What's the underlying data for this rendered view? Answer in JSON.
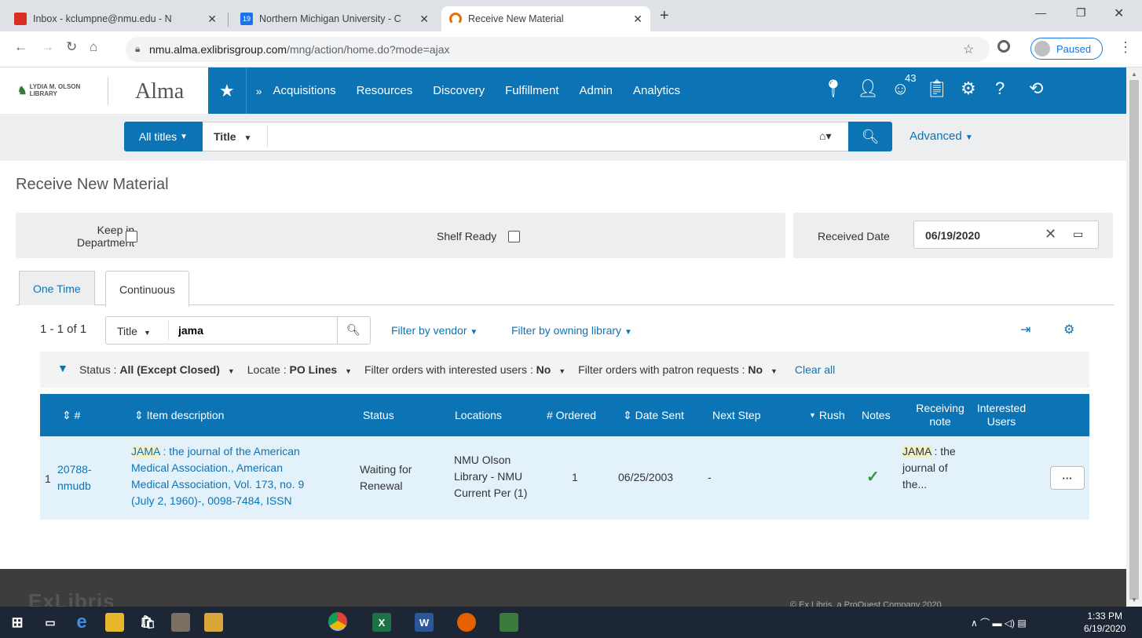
{
  "browser": {
    "tabs": [
      {
        "title": "Inbox - kclumpne@nmu.edu - N",
        "icon": "gmail-icon"
      },
      {
        "title": "Northern Michigan University - C",
        "icon": "calendar-icon",
        "badge": "19"
      },
      {
        "title": "Receive New Material",
        "icon": "exlibris-icon"
      }
    ],
    "url_host": "nmu.alma.exlibrisgroup.com",
    "url_path": "/mng/action/home.do?mode=ajax",
    "profile_label": "Paused"
  },
  "alma": {
    "library_logo_text": "LYDIA M. OLSON LIBRARY",
    "app_name": "Alma",
    "nav_items": [
      "Acquisitions",
      "Resources",
      "Discovery",
      "Fulfillment",
      "Admin",
      "Analytics"
    ],
    "task_badge": "43"
  },
  "search": {
    "scope": "All titles",
    "field": "Title",
    "value": "",
    "advanced": "Advanced"
  },
  "page": {
    "title": "Receive New Material",
    "keep_in_department_line1": "Keep in",
    "keep_in_department_line2": "Department",
    "shelf_ready": "Shelf Ready",
    "received_date_label": "Received Date",
    "received_date_value": "06/19/2020",
    "tabs": [
      "One Time",
      "Continuous"
    ],
    "active_tab": "Continuous"
  },
  "list": {
    "count": "1 - 1 of 1",
    "search_field": "Title",
    "search_value": "jama",
    "filter_vendor": "Filter by vendor",
    "filter_library": "Filter by owning library"
  },
  "facets": [
    {
      "label": "Status :",
      "value": "All (Except Closed)"
    },
    {
      "label": "Locate :",
      "value": "PO Lines"
    },
    {
      "label": "Filter orders with interested users :",
      "value": "No"
    },
    {
      "label": "Filter orders with patron requests :",
      "value": "No"
    }
  ],
  "clear_all": "Clear all",
  "table": {
    "headers": {
      "num": "#",
      "item": "Item description",
      "status": "Status",
      "locations": "Locations",
      "ordered": "# Ordered",
      "date_sent": "Date Sent",
      "next_step": "Next Step",
      "rush": "Rush",
      "notes": "Notes",
      "receiving_note": "Receiving note",
      "interested_users": "Interested Users"
    },
    "rows": [
      {
        "index": "1",
        "po_line": "20788-nmudb",
        "po_line_a": "20788-",
        "po_line_b": "nmudb",
        "item_hl": "JAMA",
        "item_line1": " : the journal of the American",
        "item_line2": "Medical Association., American",
        "item_line3": "Medical Association, Vol. 173, no. 9",
        "item_line4": "(July 2, 1960)-, 0098-7484, ISSN",
        "status_line1": "Waiting for",
        "status_line2": "Renewal",
        "loc_line1": "NMU Olson",
        "loc_line2": "Library - NMU",
        "loc_line3": "Current Per (1)",
        "ordered": "1",
        "date_sent": "06/25/2003",
        "next_step": "-",
        "note_hl": "JAMA",
        "note_line1": " : the",
        "note_line2": "journal of",
        "note_line3": "the..."
      }
    ]
  },
  "footer": {
    "left": "ExLibris",
    "right": "© Ex Libris, a ProQuest Company 2020"
  },
  "taskbar": {
    "time": "1:33 PM",
    "date": "6/19/2020"
  },
  "colors": {
    "alma_blue": "#0c74b5",
    "row_bg": "#e3f1fb",
    "highlight": "#f5efc8"
  }
}
